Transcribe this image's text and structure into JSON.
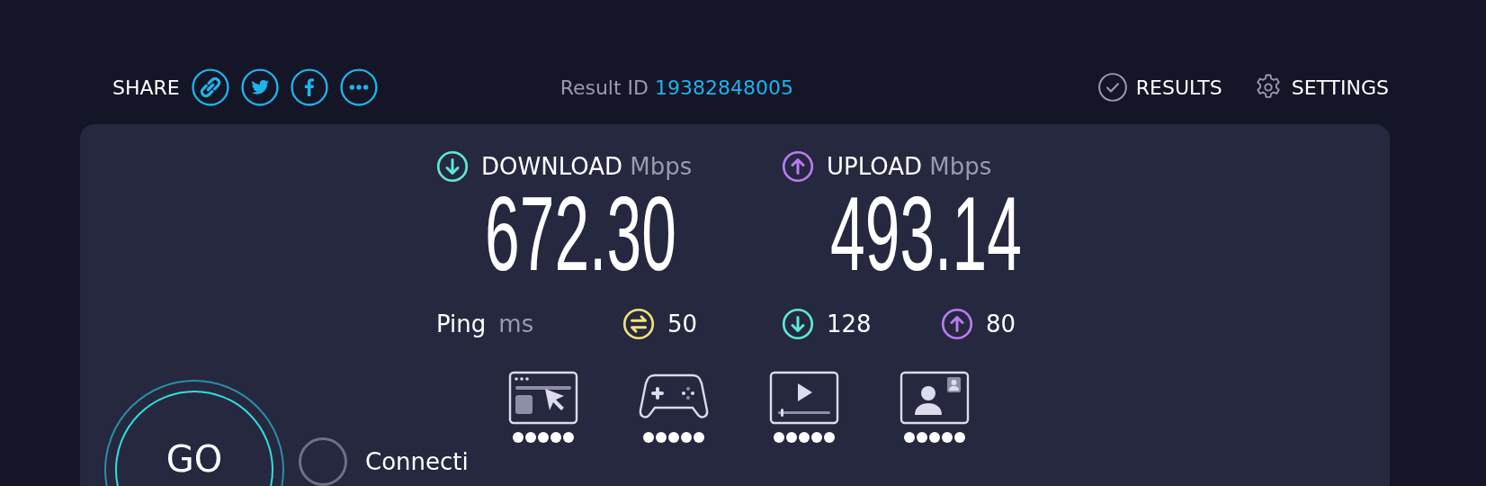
{
  "share": {
    "label": "SHARE",
    "buttons": [
      {
        "kind": "link"
      },
      {
        "kind": "twitter"
      },
      {
        "kind": "facebook"
      },
      {
        "kind": "more"
      }
    ]
  },
  "result": {
    "label": "Result ID",
    "id": "19382848005"
  },
  "nav": [
    {
      "kind": "results",
      "label": "RESULTS"
    },
    {
      "kind": "settings",
      "label": "SETTINGS"
    }
  ],
  "speeds": [
    {
      "kind": "download",
      "label": "DOWNLOAD",
      "unit": "Mbps",
      "value": "672.30",
      "color": "#5de8d8"
    },
    {
      "kind": "upload",
      "label": "UPLOAD",
      "unit": "Mbps",
      "value": "493.14",
      "color": "#b97cf0"
    }
  ],
  "ping": {
    "label": "Ping",
    "unit": "ms",
    "values": [
      {
        "kind": "idle",
        "value": "50",
        "color": "#f4e27a"
      },
      {
        "kind": "download",
        "value": "128",
        "color": "#5de8d8"
      },
      {
        "kind": "upload",
        "value": "80",
        "color": "#b97cf0"
      }
    ]
  },
  "ratings": [
    {
      "kind": "browsing",
      "stars": 5
    },
    {
      "kind": "gaming",
      "stars": 5
    },
    {
      "kind": "streaming",
      "stars": 5
    },
    {
      "kind": "video_call",
      "stars": 5
    }
  ],
  "go_button": {
    "label": "GO"
  },
  "connections": {
    "label": "Connecti"
  }
}
